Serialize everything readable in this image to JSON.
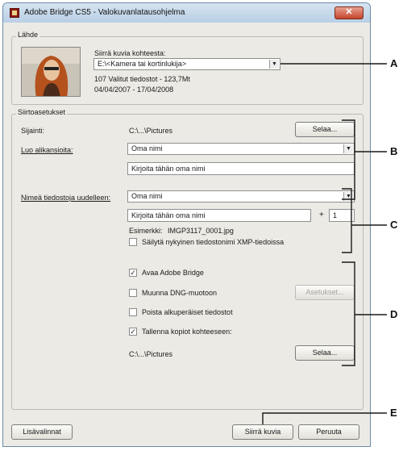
{
  "window": {
    "title": "Adobe Bridge CS5 - Valokuvanlatausohjelma"
  },
  "source_group": {
    "label": "Lähde",
    "get_photos_from_label": "Siirrä kuvia kohteesta:",
    "source_select": "E:\\<Kamera tai kortinlukija>",
    "summary": "107 Valitut tiedostot - 123,7Mt",
    "date_range": "04/04/2007 - 17/04/2008"
  },
  "transfer_group": {
    "label": "Siirtoasetukset",
    "location_label": "Sijainti:",
    "location_value": "C:\\...\\Pictures",
    "browse_label": "Selaa...",
    "create_subfolders_label": "Luo alikansioita:",
    "subfolder_select": "Oma nimi",
    "subfolder_name_field": "Kirjoita tähän oma nimi",
    "rename_files_label": "Nimeä tiedostoja uudelleen:",
    "rename_select": "Oma nimi",
    "rename_name_field": "Kirjoita tähän oma nimi",
    "plus_sign": "+",
    "start_number": "1",
    "example_label": "Esimerkki:",
    "example_value": "IMGP3117_0001.jpg",
    "preserve_xmp_label": "Säilytä nykyinen tiedostonimi XMP-tiedoissa",
    "open_bridge_label": "Avaa Adobe Bridge",
    "convert_dng_label": "Muunna DNG-muotoon",
    "settings_label": "Asetukset...",
    "delete_originals_label": "Poista alkuperäiset tiedostot",
    "save_copies_label": "Tallenna kopiot kohteeseen:",
    "copies_path": "C:\\...\\Pictures",
    "browse2_label": "Selaa..."
  },
  "footer": {
    "advanced_label": "Lisävalinnat",
    "get_photos_label": "Siirrä kuvia",
    "cancel_label": "Peruuta"
  },
  "checkboxes": {
    "preserve_xmp": false,
    "open_bridge": true,
    "convert_dng": false,
    "delete_originals": false,
    "save_copies": true
  },
  "callouts": [
    "A",
    "B",
    "C",
    "D",
    "E"
  ]
}
